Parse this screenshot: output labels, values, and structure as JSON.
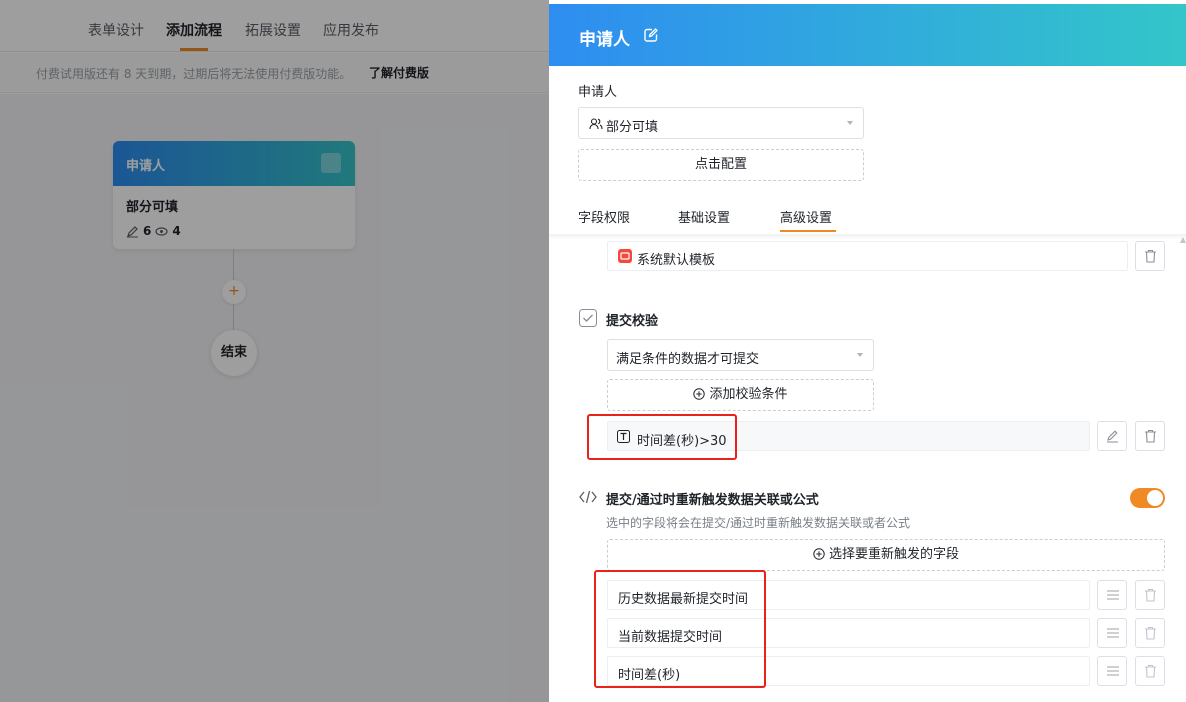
{
  "left": {
    "tabs": [
      {
        "label": "表单设计"
      },
      {
        "label": "添加流程"
      },
      {
        "label": "拓展设置"
      },
      {
        "label": "应用发布"
      }
    ],
    "notice": {
      "text": "付费试用版还有 8 天到期，过期后将无法使用付费版功能。",
      "link": "了解付费版"
    },
    "node": {
      "title": "申请人",
      "subtitle": "部分可填",
      "edit_count": "6",
      "view_count": "4"
    },
    "end_label": "结束",
    "add_label": "+"
  },
  "panel": {
    "title": "申请人",
    "applicant_label": "申请人",
    "applicant_select": "部分可填",
    "config_button": "点击配置",
    "tabs": [
      {
        "label": "字段权限"
      },
      {
        "label": "基础设置"
      },
      {
        "label": "高级设置"
      }
    ],
    "template_field": "系统默认模板",
    "submit_check": {
      "title": "提交校验",
      "select": "满足条件的数据才可提交",
      "add_button": "添加校验条件",
      "condition": "时间差(秒)>30"
    },
    "retrigger": {
      "title": "提交/通过时重新触发数据关联或公式",
      "hint": "选中的字段将会在提交/通过时重新触发数据关联或者公式",
      "select_button": "选择要重新触发的字段",
      "fields": [
        {
          "label": "历史数据最新提交时间"
        },
        {
          "label": "当前数据提交时间"
        },
        {
          "label": "时间差(秒)"
        }
      ]
    }
  },
  "colors": {
    "accent": "#f08a24",
    "header_start": "#2e8df1",
    "header_end": "#33c6c9",
    "highlight": "#e8231a"
  }
}
